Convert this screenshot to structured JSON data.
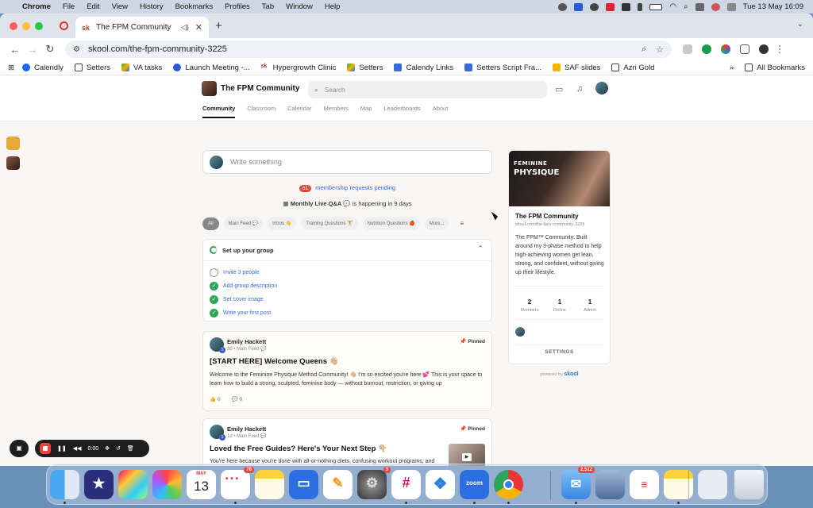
{
  "menubar": {
    "app": "Chrome",
    "items": [
      "File",
      "Edit",
      "View",
      "History",
      "Bookmarks",
      "Profiles",
      "Tab",
      "Window",
      "Help"
    ],
    "clock": "Tue 13 May  16:09"
  },
  "browser": {
    "tab_title": "The FPM Community",
    "tab_favicon": "sk",
    "url": "skool.com/the-fpm-community-3225",
    "bookmarks": [
      "Calendly",
      "Setters",
      "VA tasks",
      "Launch Meeting -...",
      "Hypergrowth Clinic",
      "Setters",
      "Calendy Links",
      "Setters Script Fra...",
      "SAF slides",
      "Azri Gold"
    ],
    "all_bookmarks": "All Bookmarks"
  },
  "site": {
    "community_name": "The FPM Community",
    "search_placeholder": "Search",
    "nav": [
      "Community",
      "Classroom",
      "Calendar",
      "Members",
      "Map",
      "Leaderboards",
      "About"
    ]
  },
  "feed": {
    "write_placeholder": "Write something",
    "pending_count": "61",
    "pending_text": "membership requests pending",
    "live_event": "Monthly Live Q&A",
    "live_suffix": "is happening in 9 days",
    "categories": [
      "All",
      "Main Feed 💬",
      "Intros 👋",
      "Training Questions 🏋",
      "Nutrition Questions 🍎",
      "More..."
    ]
  },
  "setup": {
    "title": "Set up your group",
    "items": [
      {
        "label": "Invite 3 people",
        "done": false
      },
      {
        "label": "Add group description",
        "done": true
      },
      {
        "label": "Set cover image",
        "done": true
      },
      {
        "label": "Write your first post",
        "done": true
      }
    ]
  },
  "posts": [
    {
      "author": "Emily Hackett",
      "level": "1",
      "meta": "2d • Main Feed 💬",
      "pinned": "Pinned",
      "title": "[START HERE] Welcome Queens 👋🏼",
      "body": "Welcome to the Feminine Physique Method Community! 👋🏼 I'm so excited you're here 💕 This is your space to learn how to build a strong, sculpted, feminine body — without burnout, restriction, or giving up",
      "likes": "0",
      "comments": "0"
    },
    {
      "author": "Emily Hackett",
      "level": "1",
      "meta": "1d • Main Feed 💬",
      "pinned": "Pinned",
      "title": "Loved the Free Guides? Here's Your Next Step 👇🏼",
      "body": "You're here because you're done with all-or-nothing diets, confusing workout programs, and feeling like your body doesn't reflect how hard you work. You want to feel stronger,"
    }
  ],
  "about": {
    "cover_line1": "FEMININE",
    "cover_line2": "PHYSIQUE",
    "name": "The FPM Community",
    "url": "skool.com/the-fpm-community-3225",
    "description": "The FPM™ Community: Built around my 3-phase method to help high-achieving women get lean, strong, and confident, without giving up their lifestyle.",
    "stats": [
      {
        "value": "2",
        "label": "Members"
      },
      {
        "value": "1",
        "label": "Online"
      },
      {
        "value": "1",
        "label": "Admin"
      }
    ],
    "settings": "SETTINGS",
    "powered_by": "powered by",
    "powered_brand": "skool"
  },
  "recorder": {
    "time": "0:00"
  },
  "dock": {
    "calendar_month": "MAY",
    "calendar_day": "13",
    "reminders_badge": "78",
    "settings_badge": "3",
    "mail_badge": "2,512",
    "zoom_label": "zoom"
  }
}
